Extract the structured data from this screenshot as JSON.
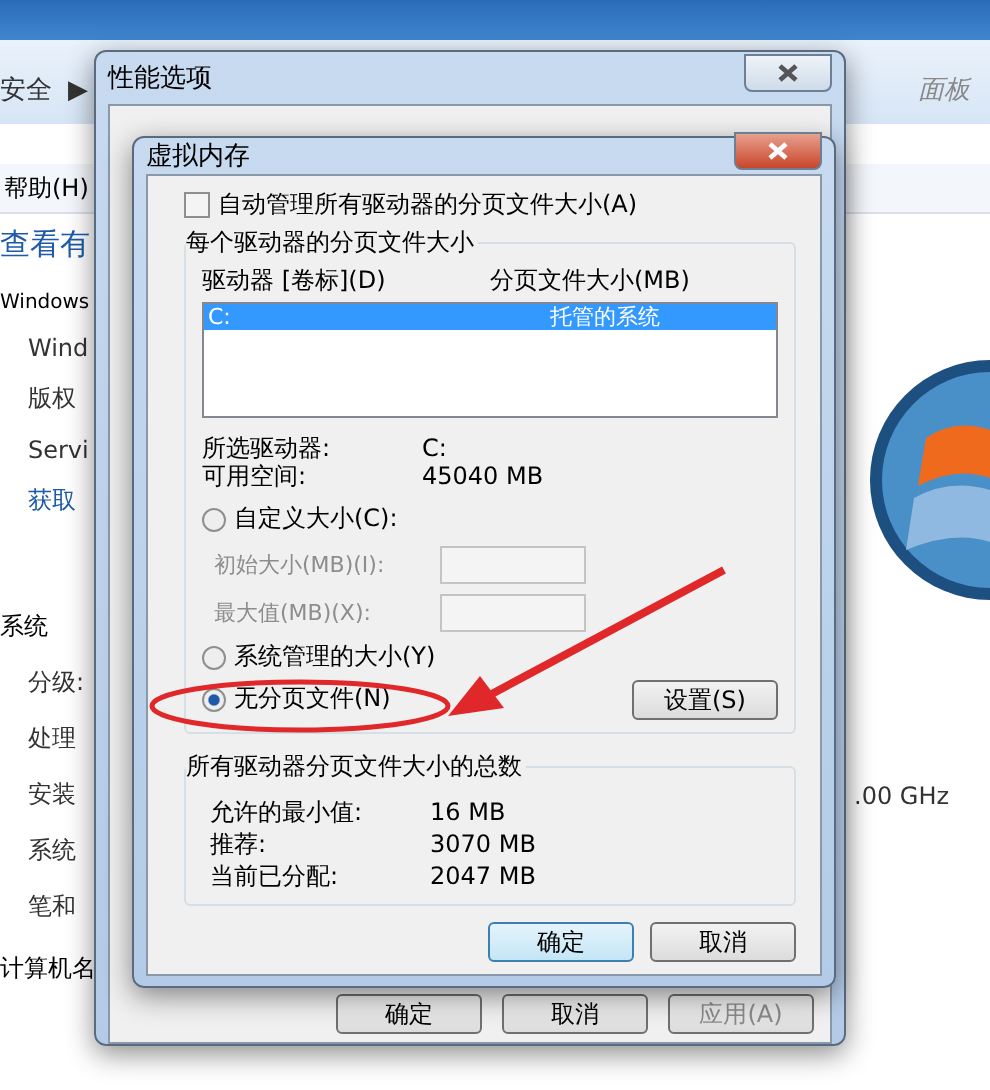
{
  "background_window": {
    "breadcrumb": [
      "安全",
      "▶"
    ],
    "search_placeholder": "面板",
    "menu": [
      "帮助(H)"
    ],
    "heading": "查看有",
    "section": "Windows",
    "items": [
      {
        "text": "Wind",
        "link": false
      },
      {
        "text": "版权",
        "link": false
      },
      {
        "text": "Servi",
        "link": false
      },
      {
        "text": "获取",
        "link": true
      }
    ],
    "system_label": "系统",
    "system_items": [
      "分级:",
      "处理",
      "安装",
      "系统",
      "笔和"
    ],
    "computer_label": "计算机名",
    "processor_speed": ".00 GHz"
  },
  "performance_dialog": {
    "title": "性能选项",
    "buttons": [
      {
        "label": "确定",
        "disabled": false
      },
      {
        "label": "取消",
        "disabled": false
      },
      {
        "label": "应用(A)",
        "disabled": true
      }
    ]
  },
  "virtual_memory_dialog": {
    "title": "虚拟内存",
    "auto_manage": {
      "label": "自动管理所有驱动器的分页文件大小(A)",
      "checked": false
    },
    "per_drive_group": "每个驱动器的分页文件大小",
    "columns": [
      "驱动器 [卷标](D)",
      "分页文件大小(MB)"
    ],
    "drives": [
      {
        "drive": "C:",
        "size": "托管的系统",
        "selected": true
      }
    ],
    "info": [
      {
        "label": "所选驱动器:",
        "value": "C:"
      },
      {
        "label": "可用空间:",
        "value": "45040 MB"
      }
    ],
    "options": [
      {
        "kind": "custom",
        "label": "自定义大小(C):",
        "selected": false,
        "fields": [
          {
            "label": "初始大小(MB)(I):",
            "disabled": true
          },
          {
            "label": "最大值(MB)(X):",
            "disabled": true
          }
        ]
      },
      {
        "kind": "plain",
        "label": "系统管理的大小(Y)",
        "selected": false
      },
      {
        "kind": "plain",
        "label": "无分页文件(N)",
        "selected": true
      }
    ],
    "set_button": "设置(S)",
    "totals_group": "所有驱动器分页文件大小的总数",
    "totals": [
      {
        "label": "允许的最小值:",
        "value": "16 MB"
      },
      {
        "label": "推荐:",
        "value": "3070 MB"
      },
      {
        "label": "当前已分配:",
        "value": "2047 MB"
      }
    ],
    "buttons": [
      {
        "label": "确定",
        "default": true
      },
      {
        "label": "取消",
        "default": false
      }
    ]
  }
}
